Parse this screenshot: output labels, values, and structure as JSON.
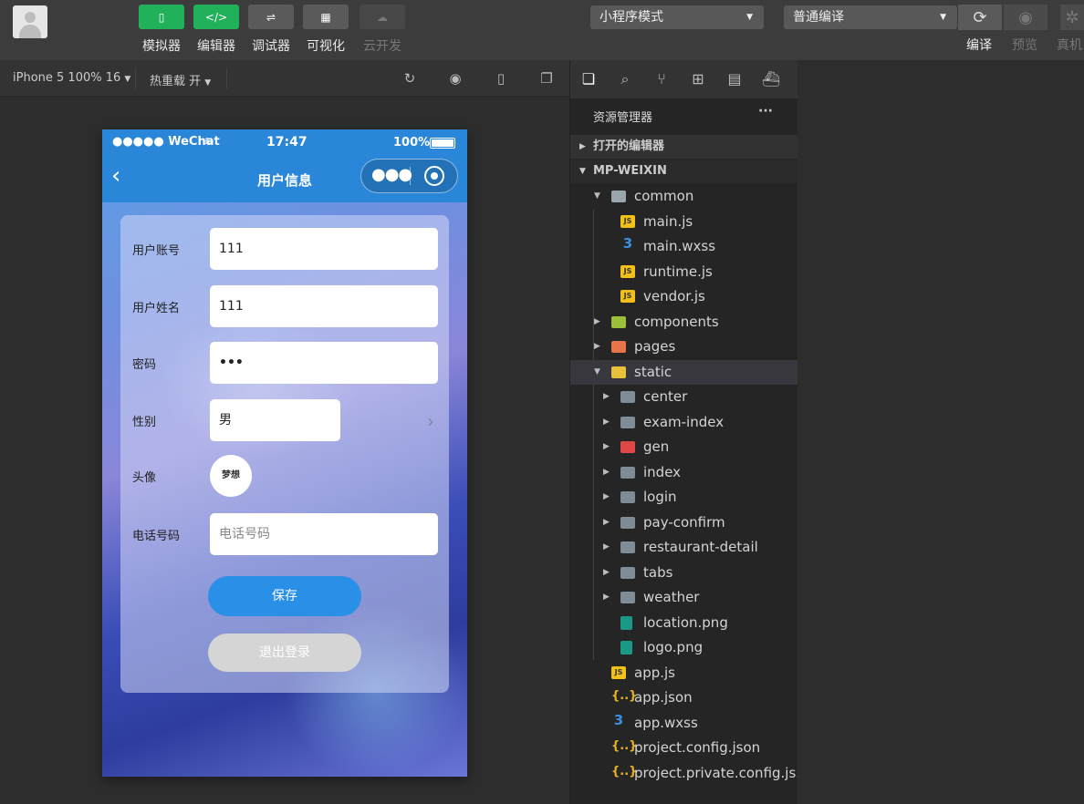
{
  "toolbar": {
    "tools": [
      {
        "label": "模拟器",
        "glyph": "▯"
      },
      {
        "label": "编辑器",
        "glyph": "</>"
      },
      {
        "label": "调试器",
        "glyph": "⇌"
      },
      {
        "label": "可视化",
        "glyph": "▦"
      },
      {
        "label": "云开发",
        "glyph": "☁"
      }
    ],
    "mode_select": "小程序模式",
    "compile_select": "普通编译",
    "right_labels": {
      "compile": "编译",
      "preview": "预览",
      "device": "真机"
    }
  },
  "simbar": {
    "device": "iPhone 5 100% 16",
    "hotreload": "热重载 开"
  },
  "phone": {
    "status": {
      "carrier": "●●●●● WeChat",
      "time": "17:47",
      "battery": "100%"
    },
    "nav_title": "用户信息",
    "form": {
      "account_label": "用户账号",
      "account_value": "111",
      "name_label": "用户姓名",
      "name_value": "111",
      "password_label": "密码",
      "password_value": "•••",
      "gender_label": "性别",
      "gender_value": "男",
      "avatar_label": "头像",
      "avatar_text": "梦想",
      "phone_label": "电话号码",
      "phone_placeholder": "电话号码"
    },
    "save_button": "保存",
    "logout_button": "退出登录"
  },
  "explorer": {
    "title": "资源管理器",
    "more": "···",
    "open_editors": "打开的编辑器",
    "project": "MP-WEIXIN",
    "tree": [
      {
        "name": "common",
        "type": "folderopen",
        "depth": 1,
        "arrow": "down"
      },
      {
        "name": "main.js",
        "type": "js",
        "depth": 2
      },
      {
        "name": "main.wxss",
        "type": "css",
        "depth": 2
      },
      {
        "name": "runtime.js",
        "type": "js",
        "depth": 2
      },
      {
        "name": "vendor.js",
        "type": "js",
        "depth": 2
      },
      {
        "name": "components",
        "type": "folder-components",
        "depth": 1,
        "arrow": "right"
      },
      {
        "name": "pages",
        "type": "folder-pages",
        "depth": 1,
        "arrow": "right"
      },
      {
        "name": "static",
        "type": "folder-static",
        "depth": 1,
        "arrow": "down",
        "selected": true
      },
      {
        "name": "center",
        "type": "folder",
        "depth": 2,
        "arrow": "right"
      },
      {
        "name": "exam-index",
        "type": "folder",
        "depth": 2,
        "arrow": "right"
      },
      {
        "name": "gen",
        "type": "folder-gen",
        "depth": 2,
        "arrow": "right"
      },
      {
        "name": "index",
        "type": "folder",
        "depth": 2,
        "arrow": "right"
      },
      {
        "name": "login",
        "type": "folder",
        "depth": 2,
        "arrow": "right"
      },
      {
        "name": "pay-confirm",
        "type": "folder",
        "depth": 2,
        "arrow": "right"
      },
      {
        "name": "restaurant-detail",
        "type": "folder",
        "depth": 2,
        "arrow": "right"
      },
      {
        "name": "tabs",
        "type": "folder",
        "depth": 2,
        "arrow": "right"
      },
      {
        "name": "weather",
        "type": "folder",
        "depth": 2,
        "arrow": "right"
      },
      {
        "name": "location.png",
        "type": "png",
        "depth": 2
      },
      {
        "name": "logo.png",
        "type": "png",
        "depth": 2
      },
      {
        "name": "app.js",
        "type": "js",
        "depth": 1
      },
      {
        "name": "app.json",
        "type": "json",
        "depth": 1
      },
      {
        "name": "app.wxss",
        "type": "css",
        "depth": 1
      },
      {
        "name": "project.config.json",
        "type": "json",
        "depth": 1
      },
      {
        "name": "project.private.config.js...",
        "type": "json",
        "depth": 1
      }
    ]
  },
  "colors": {
    "accent_green": "#20b15a",
    "nav_blue": "#2a86d8",
    "save_blue": "#2a8fe6"
  }
}
